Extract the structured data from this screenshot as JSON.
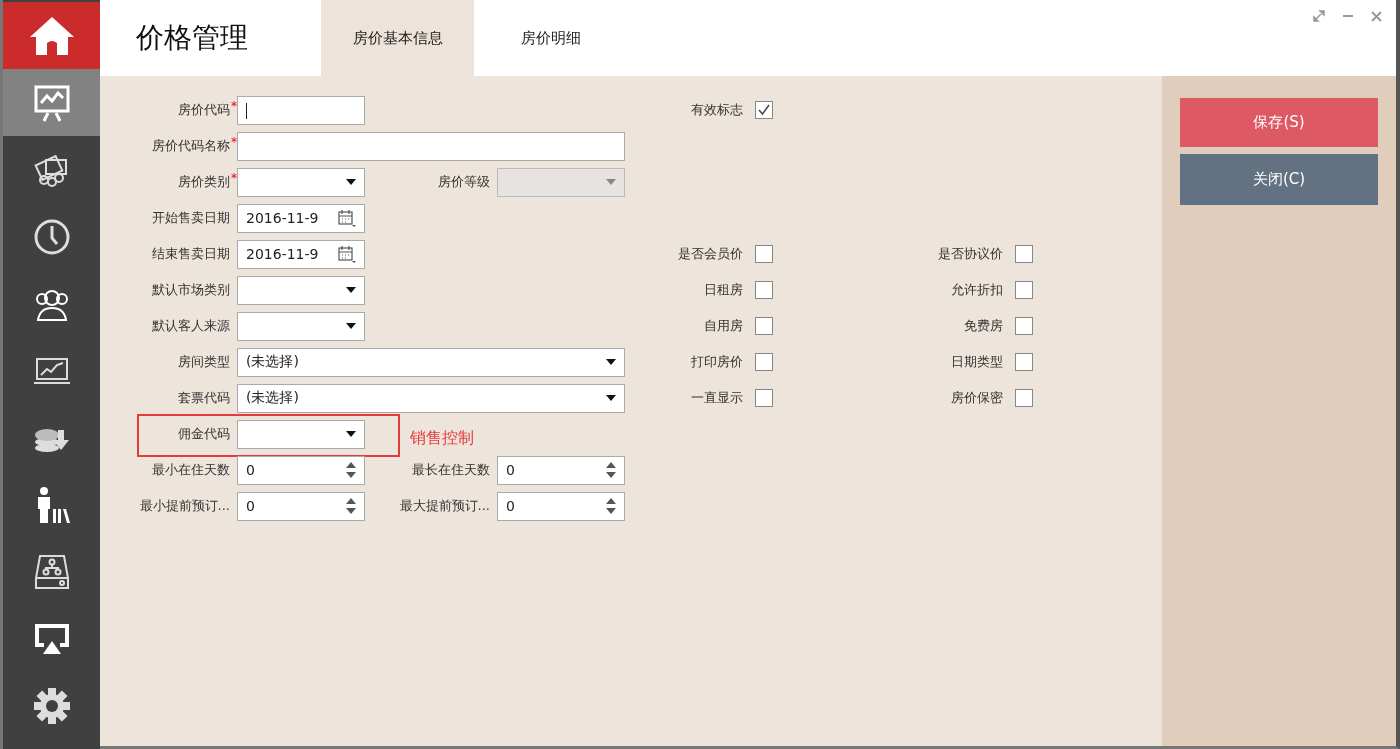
{
  "sidebar": {
    "items": [
      {
        "kind": "home",
        "selected": false
      },
      {
        "kind": "presentation",
        "selected": true
      },
      {
        "kind": "money",
        "selected": false
      },
      {
        "kind": "clock",
        "selected": false
      },
      {
        "kind": "users",
        "selected": false
      },
      {
        "kind": "laptop",
        "selected": false
      },
      {
        "kind": "coins",
        "selected": false
      },
      {
        "kind": "person",
        "selected": false
      },
      {
        "kind": "drive",
        "selected": false
      },
      {
        "kind": "screen",
        "selected": false
      },
      {
        "kind": "gear",
        "selected": false
      }
    ]
  },
  "header": {
    "title": "价格管理",
    "tabs": [
      {
        "label": "房价基本信息",
        "selected": true
      },
      {
        "label": "房价明细",
        "selected": false
      }
    ]
  },
  "form": {
    "rows": [
      {
        "fields": [
          {
            "label": "房价代码",
            "mark": "*",
            "kind": "text",
            "focused": true
          }
        ],
        "checks": [
          {
            "label": "有效标志",
            "checked": true
          }
        ]
      },
      {
        "fields": [
          {
            "label": "房价代码名称",
            "mark": "*",
            "kind": "text",
            "wide": true
          }
        ]
      },
      {
        "fields": [
          {
            "label": "房价类别",
            "mark": "*",
            "kind": "select"
          },
          {
            "label": "房价等级",
            "kind": "select",
            "disabled": true
          }
        ]
      },
      {
        "fields": [
          {
            "label": "开始售卖日期",
            "kind": "date",
            "value": "2016-11-9"
          }
        ]
      },
      {
        "fields": [
          {
            "label": "结束售卖日期",
            "kind": "date",
            "value": "2016-11-9"
          }
        ],
        "checks": [
          {
            "label": "是否会员价",
            "checked": false
          },
          {
            "label": "是否协议价",
            "checked": false
          }
        ]
      },
      {
        "fields": [
          {
            "label": "默认市场类别",
            "kind": "select"
          }
        ],
        "checks": [
          {
            "label": "日租房",
            "checked": false
          },
          {
            "label": "允许折扣",
            "checked": false
          }
        ]
      },
      {
        "fields": [
          {
            "label": "默认客人来源",
            "kind": "select"
          }
        ],
        "checks": [
          {
            "label": "自用房",
            "checked": false
          },
          {
            "label": "免费房",
            "checked": false
          }
        ]
      },
      {
        "fields": [
          {
            "label": "房间类型",
            "kind": "select",
            "wide": true,
            "value": "(未选择)"
          }
        ],
        "checks": [
          {
            "label": "打印房价",
            "checked": false
          },
          {
            "label": "日期类型",
            "checked": false
          }
        ]
      },
      {
        "fields": [
          {
            "label": "套票代码",
            "kind": "select",
            "wide": true,
            "value": "(未选择)"
          }
        ],
        "checks": [
          {
            "label": "一直显示",
            "checked": false
          },
          {
            "label": "房价保密",
            "checked": false
          }
        ]
      },
      {
        "fields": [
          {
            "label": "佣金代码",
            "kind": "select",
            "highlighted": true
          }
        ],
        "annotation": "销售控制"
      },
      {
        "fields": [
          {
            "label": "最小在住天数",
            "kind": "spin",
            "value": "0"
          },
          {
            "label": "最长在住天数",
            "kind": "spin",
            "value": "0"
          }
        ]
      },
      {
        "fields": [
          {
            "label": "最小提前预订...",
            "kind": "spin",
            "value": "0"
          },
          {
            "label": "最大提前预订...",
            "kind": "spin",
            "value": "0"
          }
        ]
      }
    ]
  },
  "actions": [
    {
      "label": "保存(S)",
      "kind": "primary"
    },
    {
      "label": "关闭(C)",
      "kind": "secondary"
    }
  ]
}
